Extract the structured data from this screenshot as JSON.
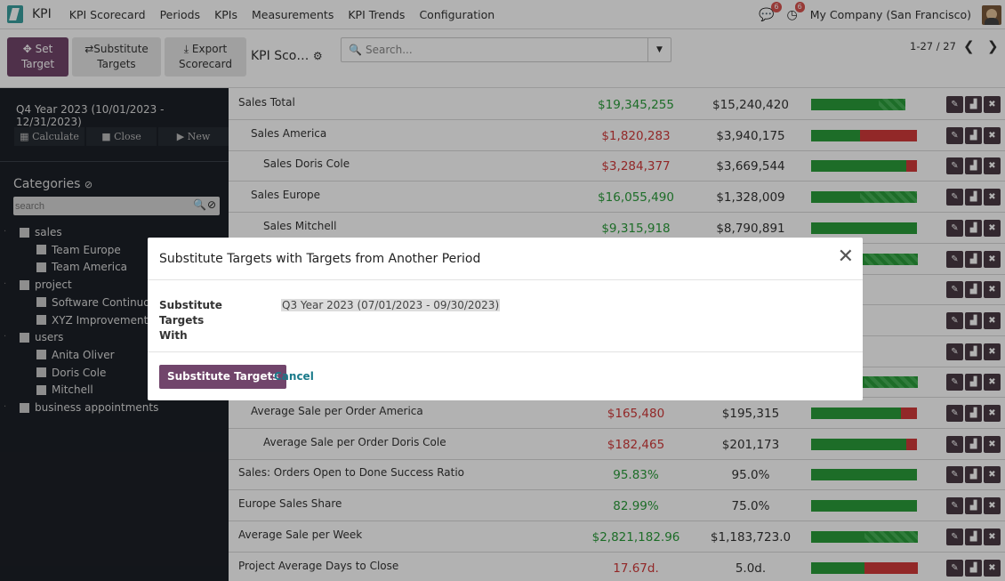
{
  "nav": {
    "app_name": "KPI",
    "menu": [
      "KPI Scorecard",
      "Periods",
      "KPIs",
      "Measurements",
      "KPI Trends",
      "Configuration"
    ],
    "chat_badge": "6",
    "activity_badge": "6",
    "company": "My Company (San Francisco)"
  },
  "control": {
    "set_target_label_1": "Set",
    "set_target_label_2": "Target",
    "substitute_label_1": "Substitute",
    "substitute_label_2": "Targets",
    "export_label_1": "Export",
    "export_label_2": "Scorecard",
    "view_title": "KPI Sco…",
    "search_placeholder": "Search...",
    "pager": "1-27 / 27"
  },
  "sidebar": {
    "period": "Q4 Year 2023 (10/01/2023 - 12/31/2023)",
    "calculate": "Calculate",
    "close": "Close",
    "new": "New",
    "categories_title": "Categories",
    "search_placeholder": "search",
    "tree": [
      {
        "label": "sales",
        "level": 0
      },
      {
        "label": "Team Europe",
        "level": 1
      },
      {
        "label": "Team America",
        "level": 1
      },
      {
        "label": "project",
        "level": 0
      },
      {
        "label": "Software Continuous",
        "level": 1
      },
      {
        "label": "XYZ Improvements",
        "level": 1
      },
      {
        "label": "users",
        "level": 0
      },
      {
        "label": "Anita Oliver",
        "level": 1
      },
      {
        "label": "Doris Cole",
        "level": 1
      },
      {
        "label": "Mitchell",
        "level": 1
      },
      {
        "label": "business appointments",
        "level": 0
      }
    ]
  },
  "rows": [
    {
      "name": "Sales Total",
      "indent": 0,
      "actual": "$19,345,255",
      "status": "green",
      "target": "$15,240,420",
      "bar_green": 0.64,
      "bar_red": 0,
      "bar_stripe": 0.25
    },
    {
      "name": "Sales America",
      "indent": 1,
      "actual": "$1,820,283",
      "status": "red",
      "target": "$3,940,175",
      "bar_green": 0.46,
      "bar_red": 0.54,
      "bar_stripe": 0
    },
    {
      "name": "Sales Doris Cole",
      "indent": 2,
      "actual": "$3,284,377",
      "status": "red",
      "target": "$3,669,544",
      "bar_green": 0.9,
      "bar_red": 0.1,
      "bar_stripe": 0
    },
    {
      "name": "Sales Europe",
      "indent": 1,
      "actual": "$16,055,490",
      "status": "green",
      "target": "$1,328,009",
      "bar_green": 0.46,
      "bar_red": 0,
      "bar_stripe": 0.54
    },
    {
      "name": "Sales Mitchell",
      "indent": 2,
      "actual": "$9,315,918",
      "status": "green",
      "target": "$8,790,891",
      "bar_green": 1.0,
      "bar_red": 0,
      "bar_stripe": 0
    },
    {
      "name": "",
      "indent": 0,
      "actual": "",
      "status": "green",
      "target": "",
      "bar_green": 0.5,
      "bar_red": 0,
      "bar_stripe": 0.5
    },
    {
      "name": "",
      "indent": 0,
      "actual": "",
      "status": "green",
      "target": "",
      "bar_green": 0,
      "bar_red": 0,
      "bar_stripe": 0
    },
    {
      "name": "",
      "indent": 0,
      "actual": "",
      "status": "green",
      "target": "",
      "bar_green": 0,
      "bar_red": 0,
      "bar_stripe": 0
    },
    {
      "name": "",
      "indent": 0,
      "actual": "",
      "status": "green",
      "target": "",
      "bar_green": 0,
      "bar_red": 0,
      "bar_stripe": 0
    },
    {
      "name": "",
      "indent": 0,
      "actual": "",
      "status": "green",
      "target": "",
      "bar_green": 0.5,
      "bar_red": 0,
      "bar_stripe": 0.5
    },
    {
      "name": "Average Sale per Order America",
      "indent": 1,
      "actual": "$165,480",
      "status": "red",
      "target": "$195,315",
      "bar_green": 0.85,
      "bar_red": 0.15,
      "bar_stripe": 0
    },
    {
      "name": "Average Sale per Order Doris Cole",
      "indent": 2,
      "actual": "$182,465",
      "status": "red",
      "target": "$201,173",
      "bar_green": 0.9,
      "bar_red": 0.1,
      "bar_stripe": 0
    },
    {
      "name": "Sales: Orders Open to Done Success Ratio",
      "indent": 0,
      "actual": "95.83%",
      "status": "green",
      "target": "95.0%",
      "bar_green": 1.0,
      "bar_red": 0,
      "bar_stripe": 0
    },
    {
      "name": "Europe Sales Share",
      "indent": 0,
      "actual": "82.99%",
      "status": "green",
      "target": "75.0%",
      "bar_green": 1.0,
      "bar_red": 0,
      "bar_stripe": 0
    },
    {
      "name": "Average Sale per Week",
      "indent": 0,
      "actual": "$2,821,182.96",
      "status": "green",
      "target": "$1,183,723.0",
      "bar_green": 0.5,
      "bar_red": 0,
      "bar_stripe": 0.5
    },
    {
      "name": "Project Average Days to Close",
      "indent": 0,
      "actual": "17.67d.",
      "status": "red",
      "target": "5.0d.",
      "bar_green": 0.5,
      "bar_red": 0.5,
      "bar_stripe": 0
    }
  ],
  "dialog": {
    "title": "Substitute Targets with Targets from Another Period",
    "label_1": "Substitute Targets",
    "label_2": "With",
    "value": "Q3 Year 2023 (07/01/2023 - 09/30/2023)",
    "confirm": "Substitute Targets",
    "cancel": "Cancel"
  },
  "colors": {
    "primary": "#71456b",
    "green": "#2a9c3a",
    "red": "#d23a3a",
    "sidebar": "#1c2027"
  }
}
